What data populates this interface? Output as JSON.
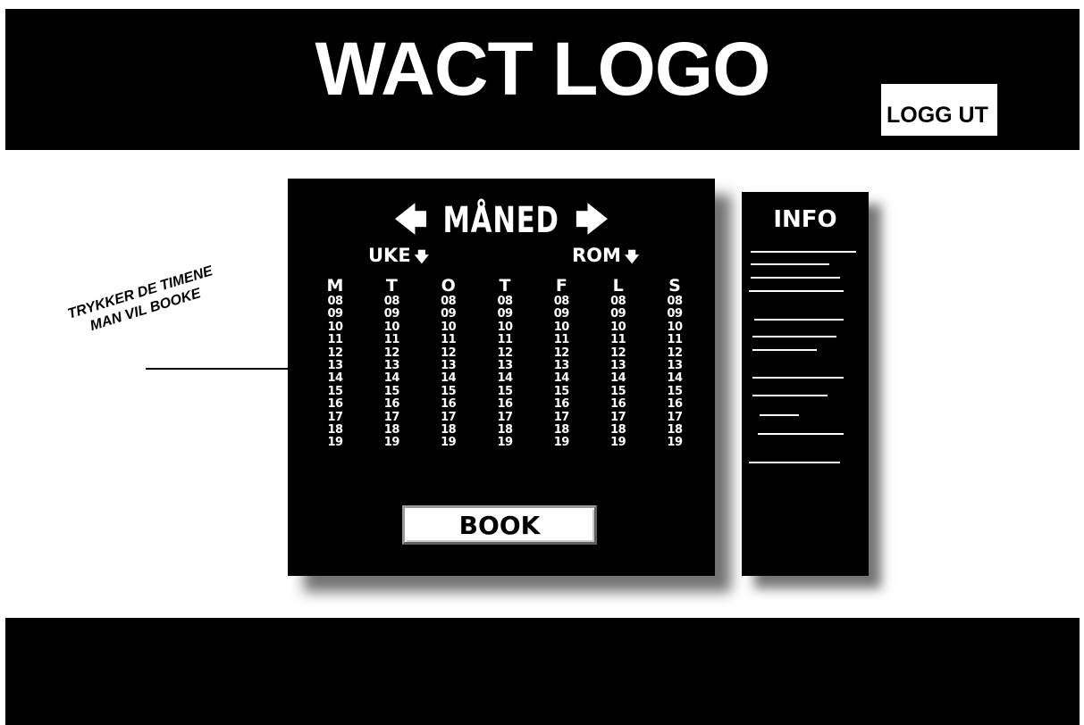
{
  "header": {
    "logo": "WACT LOGO",
    "logout_label": "LOGG UT"
  },
  "calendar": {
    "month_label": "MÅNED",
    "prev_icon": "arrow-left-icon",
    "next_icon": "arrow-right-icon",
    "week_dropdown": "UKE",
    "room_dropdown": "ROM",
    "days": [
      {
        "label": "M",
        "hours": [
          "08",
          "09",
          "10",
          "11",
          "12",
          "13",
          "14",
          "15",
          "16",
          "17",
          "18",
          "19"
        ]
      },
      {
        "label": "T",
        "hours": [
          "08",
          "09",
          "10",
          "11",
          "12",
          "13",
          "14",
          "15",
          "16",
          "17",
          "18",
          "19"
        ]
      },
      {
        "label": "O",
        "hours": [
          "08",
          "09",
          "10",
          "11",
          "12",
          "13",
          "14",
          "15",
          "16",
          "17",
          "18",
          "19"
        ]
      },
      {
        "label": "T",
        "hours": [
          "08",
          "09",
          "10",
          "11",
          "12",
          "13",
          "14",
          "15",
          "16",
          "17",
          "18",
          "19"
        ]
      },
      {
        "label": "F",
        "hours": [
          "08",
          "09",
          "10",
          "11",
          "12",
          "13",
          "14",
          "15",
          "16",
          "17",
          "18",
          "19"
        ]
      },
      {
        "label": "L",
        "hours": [
          "08",
          "09",
          "10",
          "11",
          "12",
          "13",
          "14",
          "15",
          "16",
          "17",
          "18",
          "19"
        ]
      },
      {
        "label": "S",
        "hours": [
          "08",
          "09",
          "10",
          "11",
          "12",
          "13",
          "14",
          "15",
          "16",
          "17",
          "18",
          "19"
        ]
      }
    ],
    "book_label": "BOOK"
  },
  "info": {
    "title": "INFO"
  },
  "annotation": {
    "line1": "TRYKKER DE TIMENE",
    "line2": "MAN VIL BOOKE"
  }
}
